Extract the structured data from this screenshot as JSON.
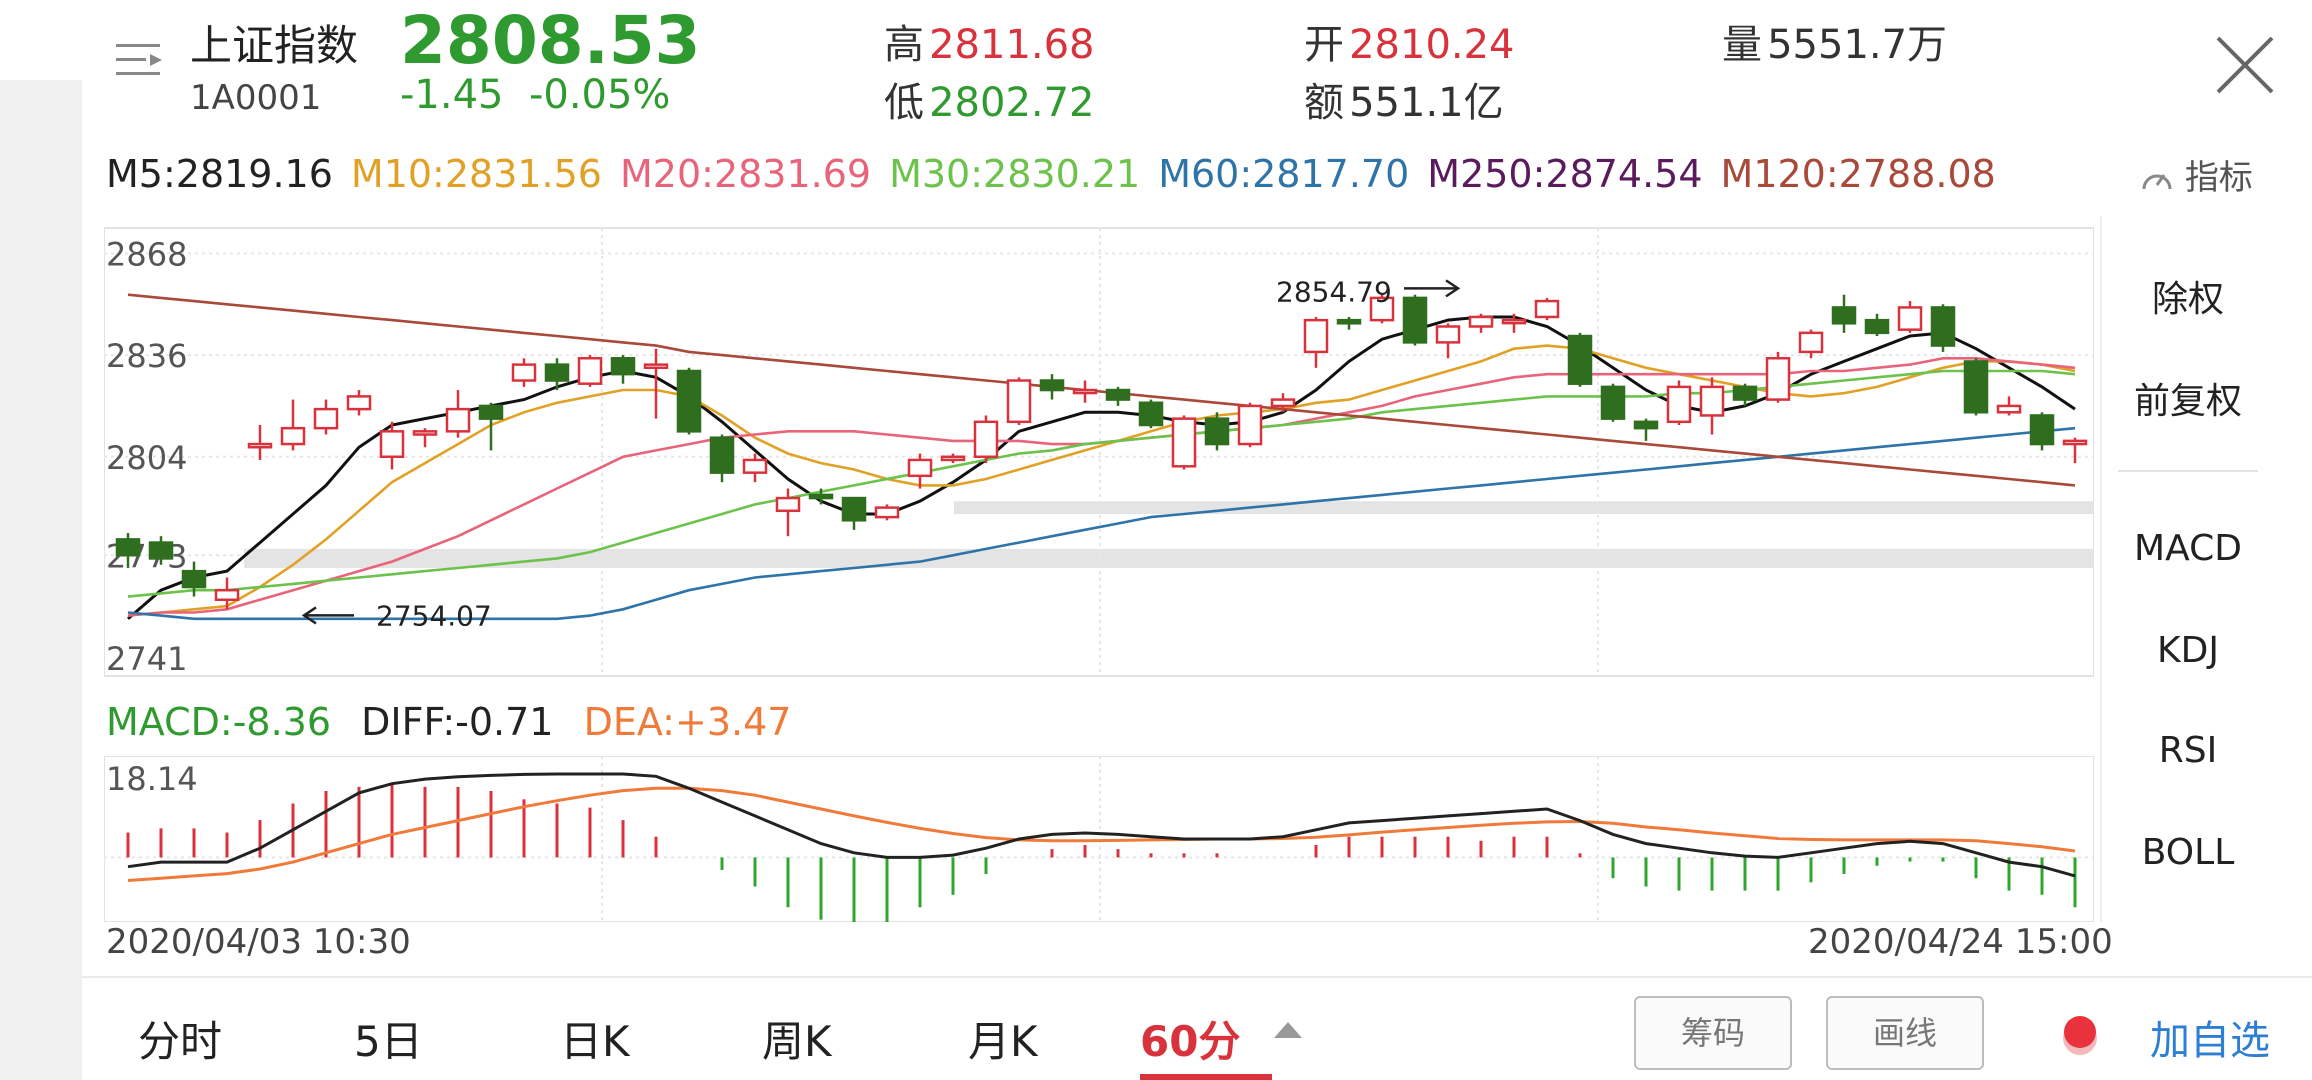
{
  "header": {
    "index_name": "上证指数",
    "index_code": "1A0001",
    "price": "2808.53",
    "change": "-1.45",
    "change_pct": "-0.05%",
    "high_label": "高",
    "high_value": "2811.68",
    "low_label": "低",
    "low_value": "2802.72",
    "open_label": "开",
    "open_value": "2810.24",
    "amount_label": "额",
    "amount_value": "551.1亿",
    "volume_label": "量",
    "volume_value": "5551.7万"
  },
  "ma_legend": [
    {
      "text": "M5:2819.16",
      "color": "#222222"
    },
    {
      "text": "M10:2831.56",
      "color": "#e0a126"
    },
    {
      "text": "M20:2831.69",
      "color": "#e8647a"
    },
    {
      "text": "M30:2830.21",
      "color": "#6cc24a"
    },
    {
      "text": "M60:2817.70",
      "color": "#2f74a8"
    },
    {
      "text": "M250:2874.54",
      "color": "#5a1a5c"
    },
    {
      "text": "M120:2788.08",
      "color": "#a8493a"
    }
  ],
  "indicator_label": "指标",
  "chart_data": {
    "type": "candlestick",
    "y_ticks": [
      "2868",
      "2836",
      "2804",
      "2773",
      "2741"
    ],
    "ylim": [
      2741,
      2868
    ],
    "annotations": {
      "high_label": "2854.79",
      "low_label": "2754.07"
    },
    "candles": [
      {
        "o": 2778,
        "c": 2773,
        "h": 2780,
        "l": 2769
      },
      {
        "o": 2777,
        "c": 2772,
        "h": 2779,
        "l": 2770
      },
      {
        "o": 2768,
        "c": 2763,
        "h": 2771,
        "l": 2760
      },
      {
        "o": 2759,
        "c": 2762,
        "h": 2766,
        "l": 2756
      },
      {
        "o": 2807,
        "c": 2808,
        "h": 2814,
        "l": 2803
      },
      {
        "o": 2808,
        "c": 2813,
        "h": 2822,
        "l": 2806
      },
      {
        "o": 2813,
        "c": 2819,
        "h": 2822,
        "l": 2811
      },
      {
        "o": 2819,
        "c": 2823,
        "h": 2825,
        "l": 2817
      },
      {
        "o": 2804,
        "c": 2812,
        "h": 2815,
        "l": 2800
      },
      {
        "o": 2811,
        "c": 2812,
        "h": 2813,
        "l": 2807
      },
      {
        "o": 2812,
        "c": 2819,
        "h": 2825,
        "l": 2810
      },
      {
        "o": 2820,
        "c": 2816,
        "h": 2821,
        "l": 2806
      },
      {
        "o": 2828,
        "c": 2833,
        "h": 2835,
        "l": 2826
      },
      {
        "o": 2833,
        "c": 2828,
        "h": 2835,
        "l": 2825
      },
      {
        "o": 2827,
        "c": 2835,
        "h": 2836,
        "l": 2826
      },
      {
        "o": 2835,
        "c": 2830,
        "h": 2836,
        "l": 2827
      },
      {
        "o": 2832,
        "c": 2833,
        "h": 2838,
        "l": 2816
      },
      {
        "o": 2831,
        "c": 2812,
        "h": 2832,
        "l": 2811
      },
      {
        "o": 2810,
        "c": 2799,
        "h": 2811,
        "l": 2796
      },
      {
        "o": 2799,
        "c": 2803,
        "h": 2805,
        "l": 2796
      },
      {
        "o": 2787,
        "c": 2791,
        "h": 2794,
        "l": 2779
      },
      {
        "o": 2792,
        "c": 2791,
        "h": 2794,
        "l": 2789
      },
      {
        "o": 2791,
        "c": 2784,
        "h": 2791,
        "l": 2781
      },
      {
        "o": 2785,
        "c": 2788,
        "h": 2789,
        "l": 2784
      },
      {
        "o": 2798,
        "c": 2803,
        "h": 2805,
        "l": 2794
      },
      {
        "o": 2803,
        "c": 2804,
        "h": 2805,
        "l": 2802
      },
      {
        "o": 2804,
        "c": 2815,
        "h": 2817,
        "l": 2802
      },
      {
        "o": 2815,
        "c": 2828,
        "h": 2829,
        "l": 2814
      },
      {
        "o": 2828,
        "c": 2825,
        "h": 2830,
        "l": 2822
      },
      {
        "o": 2825,
        "c": 2825,
        "h": 2828,
        "l": 2821
      },
      {
        "o": 2825,
        "c": 2822,
        "h": 2826,
        "l": 2820
      },
      {
        "o": 2821,
        "c": 2814,
        "h": 2822,
        "l": 2813
      },
      {
        "o": 2801,
        "c": 2816,
        "h": 2817,
        "l": 2800
      },
      {
        "o": 2816,
        "c": 2808,
        "h": 2818,
        "l": 2806
      },
      {
        "o": 2808,
        "c": 2820,
        "h": 2821,
        "l": 2807
      },
      {
        "o": 2820,
        "c": 2822,
        "h": 2824,
        "l": 2818
      },
      {
        "o": 2837,
        "c": 2847,
        "h": 2848,
        "l": 2832
      },
      {
        "o": 2847,
        "c": 2846,
        "h": 2848,
        "l": 2844
      },
      {
        "o": 2847,
        "c": 2854,
        "h": 2855,
        "l": 2846
      },
      {
        "o": 2854,
        "c": 2840,
        "h": 2855,
        "l": 2839
      },
      {
        "o": 2840,
        "c": 2845,
        "h": 2846,
        "l": 2835
      },
      {
        "o": 2845,
        "c": 2848,
        "h": 2849,
        "l": 2843
      },
      {
        "o": 2847,
        "c": 2847,
        "h": 2849,
        "l": 2843
      },
      {
        "o": 2848,
        "c": 2853,
        "h": 2854,
        "l": 2847
      },
      {
        "o": 2842,
        "c": 2827,
        "h": 2843,
        "l": 2826
      },
      {
        "o": 2826,
        "c": 2816,
        "h": 2827,
        "l": 2815
      },
      {
        "o": 2815,
        "c": 2813,
        "h": 2816,
        "l": 2809
      },
      {
        "o": 2815,
        "c": 2826,
        "h": 2828,
        "l": 2814
      },
      {
        "o": 2817,
        "c": 2826,
        "h": 2829,
        "l": 2811
      },
      {
        "o": 2826,
        "c": 2822,
        "h": 2827,
        "l": 2820
      },
      {
        "o": 2822,
        "c": 2835,
        "h": 2837,
        "l": 2821
      },
      {
        "o": 2837,
        "c": 2843,
        "h": 2844,
        "l": 2835
      },
      {
        "o": 2851,
        "c": 2846,
        "h": 2855,
        "l": 2843
      },
      {
        "o": 2847,
        "c": 2843,
        "h": 2849,
        "l": 2842
      },
      {
        "o": 2844,
        "c": 2851,
        "h": 2853,
        "l": 2843
      },
      {
        "o": 2851,
        "c": 2839,
        "h": 2852,
        "l": 2837
      },
      {
        "o": 2834,
        "c": 2818,
        "h": 2835,
        "l": 2817
      },
      {
        "o": 2818,
        "c": 2820,
        "h": 2823,
        "l": 2817
      },
      {
        "o": 2817,
        "c": 2808,
        "h": 2818,
        "l": 2806
      },
      {
        "o": 2808,
        "c": 2809,
        "h": 2810,
        "l": 2802
      }
    ],
    "ma_lines": [
      {
        "name": "M5",
        "color": "#111111",
        "values": [
          2753,
          2762,
          2766,
          2768,
          2777,
          2786,
          2795,
          2807,
          2814,
          2816,
          2818,
          2820,
          2822,
          2826,
          2829,
          2831,
          2829,
          2823,
          2815,
          2806,
          2797,
          2790,
          2786,
          2786,
          2790,
          2796,
          2803,
          2812,
          2815,
          2818,
          2818,
          2817,
          2815,
          2814,
          2815,
          2818,
          2825,
          2834,
          2841,
          2844,
          2847,
          2848,
          2848,
          2845,
          2839,
          2832,
          2825,
          2820,
          2818,
          2820,
          2824,
          2830,
          2834,
          2838,
          2842,
          2843,
          2838,
          2832,
          2826,
          2819
        ]
      },
      {
        "name": "M10",
        "color": "#e0a126",
        "values": [
          2754,
          2755,
          2756,
          2757,
          2763,
          2770,
          2778,
          2787,
          2796,
          2802,
          2808,
          2814,
          2818,
          2821,
          2823,
          2825,
          2825,
          2823,
          2817,
          2810,
          2805,
          2802,
          2800,
          2797,
          2795,
          2795,
          2797,
          2800,
          2803,
          2806,
          2809,
          2812,
          2815,
          2817,
          2818,
          2819,
          2821,
          2822,
          2825,
          2828,
          2831,
          2834,
          2838,
          2839,
          2838,
          2835,
          2832,
          2830,
          2828,
          2826,
          2824,
          2823,
          2824,
          2826,
          2829,
          2832,
          2834,
          2834,
          2833,
          2831
        ]
      },
      {
        "name": "M20",
        "color": "#e8647a",
        "values": [
          2754,
          2755,
          2755,
          2756,
          2759,
          2762,
          2765,
          2768,
          2771,
          2775,
          2779,
          2784,
          2789,
          2794,
          2799,
          2804,
          2806,
          2808,
          2810,
          2811,
          2812,
          2812,
          2812,
          2811,
          2810,
          2809,
          2809,
          2809,
          2808,
          2808,
          2809,
          2810,
          2811,
          2812,
          2813,
          2814,
          2816,
          2818,
          2820,
          2823,
          2825,
          2827,
          2829,
          2830,
          2830,
          2830,
          2830,
          2830,
          2830,
          2830,
          2830,
          2831,
          2831,
          2832,
          2833,
          2835,
          2835,
          2834,
          2833,
          2832
        ]
      },
      {
        "name": "M30",
        "color": "#6cc24a",
        "values": [
          2760,
          2761,
          2762,
          2762,
          2763,
          2764,
          2765,
          2766,
          2767,
          2768,
          2769,
          2770,
          2771,
          2772,
          2774,
          2777,
          2780,
          2783,
          2786,
          2789,
          2791,
          2793,
          2795,
          2797,
          2799,
          2801,
          2803,
          2805,
          2806,
          2808,
          2809,
          2810,
          2811,
          2812,
          2813,
          2814,
          2815,
          2816,
          2818,
          2819,
          2820,
          2821,
          2822,
          2823,
          2823,
          2823,
          2823,
          2824,
          2824,
          2825,
          2826,
          2827,
          2828,
          2829,
          2830,
          2831,
          2831,
          2831,
          2831,
          2830
        ]
      },
      {
        "name": "M60",
        "color": "#2f74a8",
        "values": [
          2755,
          2754,
          2753,
          2753,
          2753,
          2753,
          2753,
          2753,
          2753,
          2753,
          2753,
          2753,
          2753,
          2753,
          2754,
          2756,
          2759,
          2762,
          2764,
          2766,
          2767,
          2768,
          2769,
          2770,
          2771,
          2773,
          2775,
          2777,
          2779,
          2781,
          2783,
          2785,
          2786,
          2787,
          2788,
          2789,
          2790,
          2791,
          2792,
          2793,
          2794,
          2795,
          2796,
          2797,
          2798,
          2799,
          2800,
          2801,
          2802,
          2803,
          2804,
          2805,
          2806,
          2807,
          2808,
          2809,
          2810,
          2811,
          2812,
          2813
        ]
      },
      {
        "name": "M120",
        "color": "#a8493a",
        "values": [
          2855,
          2854,
          2853,
          2852,
          2851,
          2850,
          2849,
          2848,
          2847,
          2846,
          2845,
          2844,
          2843,
          2842,
          2841,
          2840,
          2839,
          2837,
          2836,
          2835,
          2834,
          2833,
          2832,
          2831,
          2830,
          2829,
          2828,
          2827,
          2826,
          2825,
          2824,
          2823,
          2822,
          2821,
          2820,
          2819,
          2818,
          2817,
          2816,
          2815,
          2814,
          2813,
          2812,
          2811,
          2810,
          2809,
          2808,
          2807,
          2806,
          2805,
          2804,
          2803,
          2802,
          2801,
          2800,
          2799,
          2798,
          2797,
          2796,
          2795
        ]
      }
    ],
    "macd": {
      "label_macd": "MACD:-8.36",
      "label_diff": "DIFF:-0.71",
      "label_dea": "DEA:+3.47",
      "top_tick": "18.14",
      "diff": [
        -2,
        -1,
        -1,
        -1,
        2,
        6,
        10,
        14,
        16,
        17,
        17.5,
        17.8,
        18,
        18.1,
        18.1,
        18.1,
        17.6,
        15,
        12,
        9,
        6,
        3,
        1,
        0,
        0,
        0.5,
        2,
        4,
        5,
        5.3,
        5,
        4.5,
        4,
        4,
        4,
        4.5,
        6,
        7.5,
        8,
        8.5,
        9,
        9.5,
        10,
        10.5,
        8,
        5,
        3,
        2,
        1,
        0.3,
        0,
        1,
        2,
        3,
        3.5,
        3,
        1,
        -1,
        -2,
        -4
      ],
      "dea": [
        -5,
        -4.5,
        -4,
        -3.5,
        -2.5,
        -1,
        1,
        3,
        5,
        6.5,
        8,
        9.5,
        11,
        12.3,
        13.5,
        14.5,
        15,
        15,
        14.5,
        13.5,
        12,
        10.5,
        9,
        7.6,
        6.3,
        5.2,
        4.3,
        3.8,
        3.6,
        3.6,
        3.7,
        3.8,
        3.9,
        4,
        4,
        4.1,
        4.4,
        4.9,
        5.5,
        6,
        6.5,
        7,
        7.4,
        7.7,
        7.8,
        7.4,
        6.6,
        6,
        5.3,
        4.7,
        4.1,
        3.9,
        3.8,
        3.8,
        3.8,
        3.8,
        3.6,
        3,
        2.3,
        1.4
      ],
      "bars": [
        6,
        7,
        7,
        6,
        9,
        13,
        16,
        17,
        18,
        17,
        17,
        16,
        14,
        13,
        12,
        9,
        5,
        0,
        -3,
        -7,
        -12,
        -15,
        -16,
        -16,
        -12,
        -9,
        -4,
        0,
        2,
        3,
        2,
        1,
        1,
        1,
        0,
        0,
        3,
        5,
        5,
        5,
        5,
        4,
        5,
        5,
        1,
        -5,
        -7,
        -8,
        -8,
        -8,
        -8,
        -6,
        -4,
        -2,
        -1,
        -1,
        -5,
        -8,
        -9,
        -12
      ]
    },
    "x_start": "2020/04/03 10:30",
    "x_end": "2020/04/24 15:00"
  },
  "right_panel": {
    "exright": "除权",
    "forward": "前复权",
    "macd": "MACD",
    "kdj": "KDJ",
    "rsi": "RSI",
    "boll": "BOLL"
  },
  "tabs": [
    {
      "label": "分时"
    },
    {
      "label": "5日"
    },
    {
      "label": "日K"
    },
    {
      "label": "周K"
    },
    {
      "label": "月K"
    },
    {
      "label": "60分"
    }
  ],
  "buttons": {
    "chips": "筹码",
    "draw": "画线",
    "add_fav": "加自选"
  },
  "colors": {
    "up": "#d8323c",
    "down": "#2e6e1e",
    "grid": "#e6e6e6",
    "accent": "#d8323c"
  }
}
